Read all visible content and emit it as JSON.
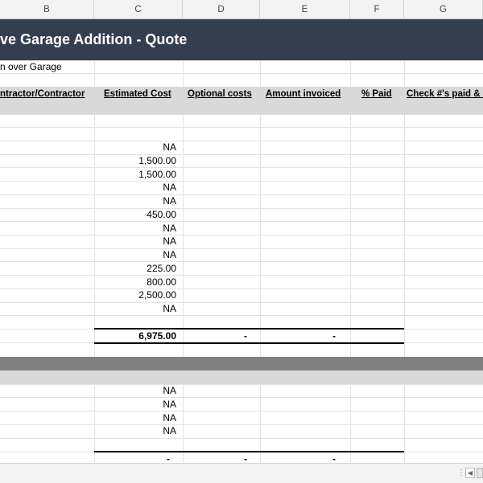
{
  "columns": [
    "B",
    "C",
    "D",
    "E",
    "F",
    "G"
  ],
  "title": "ve Garage Addition - Quote",
  "subtitle": "n over Garage",
  "headers": {
    "subcontractor": "ntractor/Contractor",
    "estimated_cost": "Estimated Cost",
    "optional_costs": "Optional costs",
    "amount_invoiced": "Amount invoiced",
    "pct_paid": "% Paid",
    "check_paid": "Check #'s paid & d"
  },
  "section1_costs": [
    "NA",
    "1,500.00",
    "1,500.00",
    "NA",
    "NA",
    "450.00",
    "NA",
    "NA",
    "NA",
    "225.00",
    "800.00",
    "2,500.00",
    "NA"
  ],
  "section1_totals": {
    "estimated": "6,975.00",
    "optional": "-",
    "invoiced": "-"
  },
  "section2_costs": [
    "NA",
    "NA",
    "NA",
    "NA"
  ],
  "section2_totals": {
    "estimated": "-",
    "optional": "-",
    "invoiced": "-"
  },
  "colors": {
    "banner": "#333f4f",
    "header_band": "#d9d9d9",
    "dark_band": "#808080"
  }
}
